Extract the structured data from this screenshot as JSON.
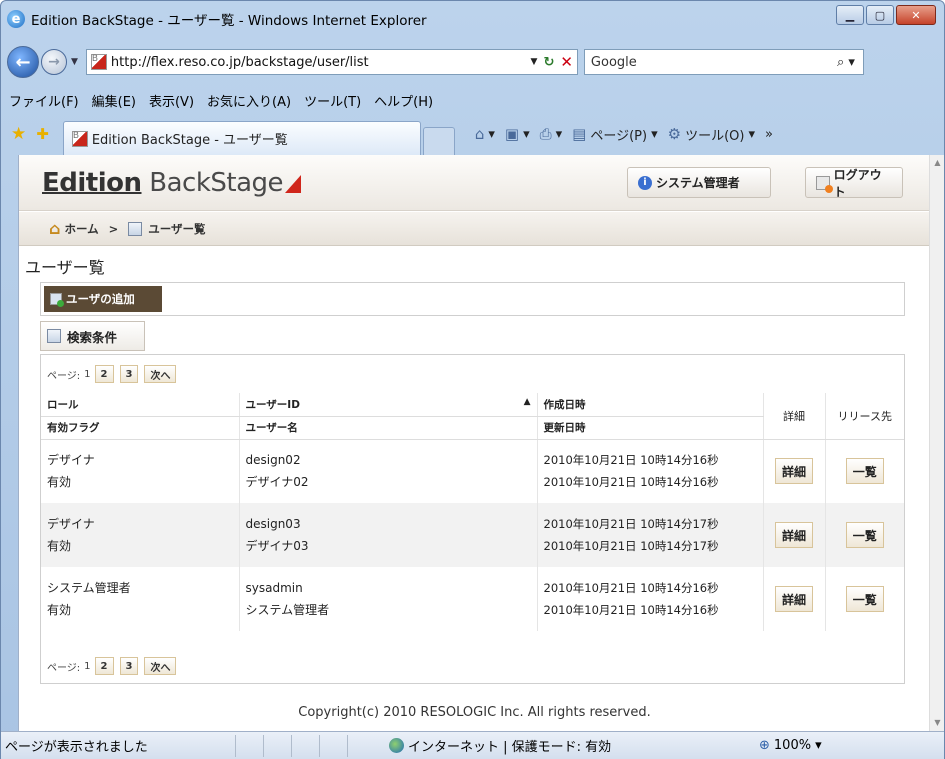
{
  "browser": {
    "title": "Edition BackStage - ユーザー覧 - Windows Internet Explorer",
    "url": "http://flex.reso.co.jp/backstage/user/list",
    "search_engine": "Google",
    "menu": [
      "ファイル(F)",
      "編集(E)",
      "表示(V)",
      "お気に入り(A)",
      "ツール(T)",
      "ヘルプ(H)"
    ],
    "tab_label": "Edition BackStage - ユーザー覧",
    "cmd_page": "ページ(P)",
    "cmd_tools": "ツール(O)",
    "status_text": "ページが表示されました",
    "status_zone": "インターネット | 保護モード: 有効",
    "status_zoom": "100%"
  },
  "app": {
    "logo_bold": "Edition",
    "logo_rest": " BackStage",
    "admin_button": "システム管理者",
    "logout_button": "ログアウト",
    "breadcrumb": {
      "home": "ホーム",
      "separator": ">",
      "current": "ユーザー覧"
    },
    "page_title": "ユーザー覧",
    "add_user_button": "ユーザの追加",
    "search_conditions_button": "検索条件",
    "pager": {
      "label": "ページ:",
      "current": "1",
      "pages": [
        "2",
        "3"
      ],
      "next": "次へ"
    },
    "table": {
      "headers": {
        "role": "ロール",
        "user_id": "ユーザーID",
        "sort_indicator": "▲",
        "created": "作成日時",
        "active_flag": "有効フラグ",
        "user_name": "ユーザー名",
        "updated": "更新日時",
        "detail": "詳細",
        "release": "リリース先"
      },
      "rows": [
        {
          "role": "デザイナ",
          "active": "有効",
          "user_id": "design02",
          "user_name": "デザイナ02",
          "created": "2010年10月21日 10時14分16秒",
          "updated": "2010年10月21日 10時14分16秒",
          "detail_button": "詳細",
          "release_button": "一覧"
        },
        {
          "role": "デザイナ",
          "active": "有効",
          "user_id": "design03",
          "user_name": "デザイナ03",
          "created": "2010年10月21日 10時14分17秒",
          "updated": "2010年10月21日 10時14分17秒",
          "detail_button": "詳細",
          "release_button": "一覧"
        },
        {
          "role": "システム管理者",
          "active": "有効",
          "user_id": "sysadmin",
          "user_name": "システム管理者",
          "created": "2010年10月21日 10時14分16秒",
          "updated": "2010年10月21日 10時14分16秒",
          "detail_button": "詳細",
          "release_button": "一覧"
        }
      ]
    },
    "footer": "Copyright(c) 2010 RESOLOGIC Inc. All rights reserved."
  }
}
